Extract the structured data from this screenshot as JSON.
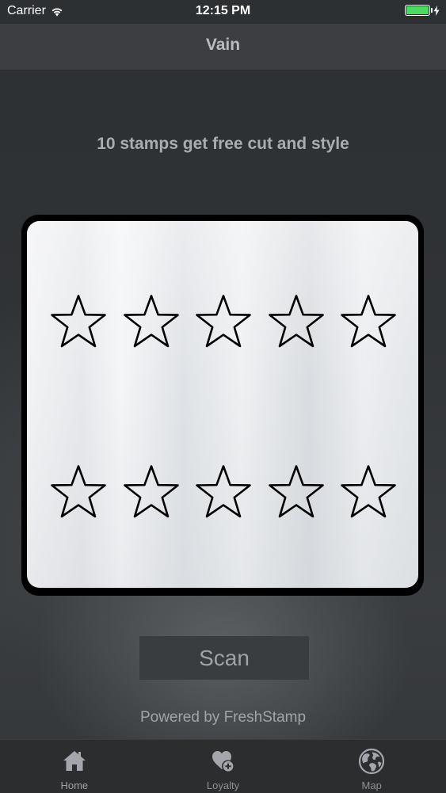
{
  "status_bar": {
    "carrier": "Carrier",
    "time": "12:15 PM",
    "battery_level": 1.0,
    "battery_color": "#4cd964"
  },
  "nav": {
    "title": "Vain"
  },
  "promo": {
    "text": "10 stamps get free cut and style"
  },
  "stamp_card": {
    "total_stamps": 10,
    "collected_stamps": 0,
    "rows": [
      [
        "star-empty-icon",
        "star-empty-icon",
        "star-empty-icon",
        "star-empty-icon",
        "star-empty-icon"
      ],
      [
        "star-empty-icon",
        "star-empty-icon",
        "star-empty-icon",
        "star-empty-icon",
        "star-empty-icon"
      ]
    ]
  },
  "actions": {
    "scan_label": "Scan"
  },
  "footer": {
    "powered_by": "Powered by FreshStamp"
  },
  "tab_bar": {
    "tabs": [
      {
        "label": "Home",
        "icon": "home-icon",
        "active": true
      },
      {
        "label": "Loyalty",
        "icon": "heart-plus-icon",
        "active": false
      },
      {
        "label": "Map",
        "icon": "globe-icon",
        "active": false
      }
    ]
  },
  "colors": {
    "background": "#303336",
    "nav_bar": "#3c3e41",
    "card_border": "#000000",
    "text_muted": "#a9adb1",
    "tab_bar": "#2b2d2f"
  }
}
